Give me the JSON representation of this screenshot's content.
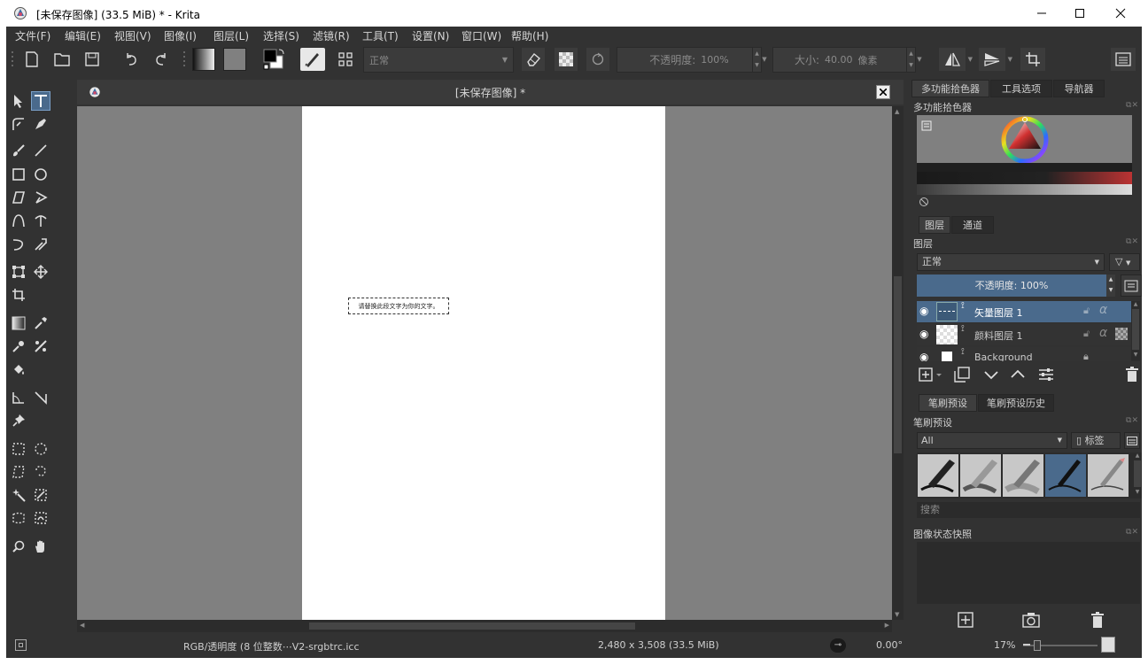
{
  "window": {
    "title": "[未保存图像]  (33.5 MiB)  * - Krita",
    "icons": {
      "app": "krita-logo-icon",
      "minimize": "minimize-icon",
      "maximize": "maximize-icon",
      "close": "close-icon"
    }
  },
  "menu": [
    "文件(F)",
    "编辑(E)",
    "视图(V)",
    "图像(I)",
    "图层(L)",
    "选择(S)",
    "滤镜(R)",
    "工具(T)",
    "设置(N)",
    "窗口(W)",
    "帮助(H)"
  ],
  "toolbar": {
    "blend_mode": "正常",
    "opacity_label": "不透明度:",
    "opacity_value": "100%",
    "size_label": "大小:",
    "size_value": "40.00",
    "size_unit": "像素"
  },
  "document": {
    "title": "[未保存图像]  *",
    "text_content": "请替换此段文字为你的文字。"
  },
  "dockers": {
    "top_tabs": [
      "多功能拾色器",
      "工具选项",
      "导航器"
    ],
    "color_selector_title": "多功能拾色器",
    "layers_tabs": [
      "图层",
      "通道"
    ],
    "layers_title": "图层",
    "layer_blend_mode": "正常",
    "layer_opacity": "不透明度:  100%",
    "layers": [
      {
        "name": "矢量图层  1",
        "selected": true
      },
      {
        "name": "颜料图层  1",
        "selected": false
      },
      {
        "name": "Background",
        "selected": false
      }
    ],
    "presets_tabs": [
      "笔刷预设",
      "笔刷预设历史"
    ],
    "presets_title": "笔刷预设",
    "presets_filter": "All",
    "presets_tag": "标签",
    "presets_search": "搜索",
    "snapshots_title": "图像状态快照"
  },
  "status": {
    "color_space": "RGB/透明度 (8 位整数⋯V2-srgbtrc.icc",
    "dimensions": "2,480 x 3,508 (33.5 MiB)",
    "rotation": "0.00°",
    "zoom": "17%"
  },
  "colors": {
    "accent": "#4a6a8c",
    "panel_bg": "#323232",
    "canvas_bg": "#808080"
  }
}
